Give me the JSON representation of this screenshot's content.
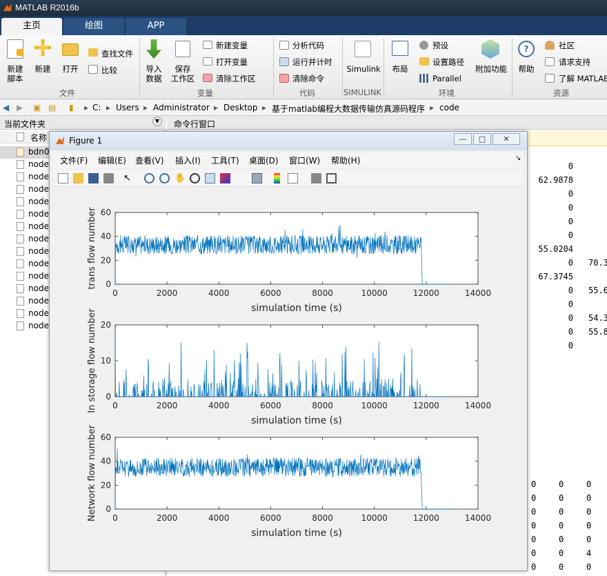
{
  "app": {
    "title": "MATLAB R2016b"
  },
  "tabs": [
    {
      "label": "主页"
    },
    {
      "label": "绘图"
    },
    {
      "label": "APP"
    }
  ],
  "ribbon": {
    "new_script": "新建\n脚本",
    "new": "新建",
    "open": "打开",
    "find_files": "查找文件",
    "compare": "比较",
    "import": "导入\n数据",
    "save_ws": "保存\n工作区",
    "new_var": "新建变量",
    "open_var": "打开变量",
    "clear_ws": "清除工作区",
    "analyze": "分析代码",
    "run_time": "运行并计时",
    "clear_cmd": "清除命令",
    "simulink": "Simulink",
    "layout": "布局",
    "prefs": "预设",
    "set_path": "设置路径",
    "parallel": "Parallel",
    "addons": "附加功能",
    "help": "帮助",
    "community": "社区",
    "support": "请求支持",
    "learn": "了解 MATLAB",
    "groups": {
      "file": "文件",
      "var": "变量",
      "code": "代码",
      "simulink": "SIMULINK",
      "env": "环境",
      "res": "资源"
    }
  },
  "path": {
    "crumbs": [
      "C:",
      "Users",
      "Administrator",
      "Desktop",
      "基于matlab编程大数据传输仿真源码程序",
      "code"
    ]
  },
  "left_panel": {
    "title": "当前文件夹",
    "col_name": "名称",
    "files": [
      "bdn0",
      "node",
      "node",
      "node",
      "node",
      "node",
      "node",
      "node",
      "node",
      "node",
      "node",
      "node",
      "node",
      "node",
      "node"
    ]
  },
  "command_window": {
    "title": "命令行窗口",
    "values_right": [
      {
        "v": "0",
        "c2": ""
      },
      {
        "v": "62.9878",
        "c2": ""
      },
      {
        "v": "0",
        "c2": ""
      },
      {
        "v": "0",
        "c2": ""
      },
      {
        "v": "0",
        "c2": ""
      },
      {
        "v": "0",
        "c2": ""
      },
      {
        "v": "55.0204",
        "c2": ""
      },
      {
        "v": "0",
        "c2": "70.3"
      },
      {
        "v": "67.3745",
        "c2": ""
      },
      {
        "v": "0",
        "c2": "55.6"
      },
      {
        "v": "0",
        "c2": ""
      },
      {
        "v": "0",
        "c2": "54.3"
      },
      {
        "v": "0",
        "c2": "55.8"
      },
      {
        "v": "0",
        "c2": ""
      }
    ],
    "matrix_rows": [
      [
        "0",
        "0",
        "0"
      ],
      [
        "0",
        "0",
        "0"
      ],
      [
        "0",
        "0",
        "0"
      ],
      [
        "0",
        "0",
        "0"
      ],
      [
        "0",
        "0",
        "0"
      ],
      [
        "0",
        "0",
        "4"
      ],
      [
        "0",
        "0",
        "0"
      ]
    ]
  },
  "figure": {
    "title": "Figure 1",
    "menus": [
      "文件(F)",
      "编辑(E)",
      "查看(V)",
      "插入(I)",
      "工具(T)",
      "桌面(D)",
      "窗口(W)",
      "帮助(H)"
    ],
    "win_buttons": {
      "min": "—",
      "max": "□",
      "close": "✕"
    }
  },
  "chart_data": [
    {
      "type": "line",
      "xlabel": "simulation time (s)",
      "ylabel": "trans flow number",
      "xlim": [
        0,
        14000
      ],
      "ylim": [
        0,
        60
      ],
      "xticks": [
        "0",
        "2000",
        "4000",
        "6000",
        "8000",
        "10000",
        "12000",
        "14000"
      ],
      "yticks": [
        "0",
        "20",
        "40",
        "60"
      ],
      "series": [
        {
          "x": [
            0,
            50,
            100,
            11750,
            11800,
            11850,
            13000
          ],
          "y": [
            0,
            38,
            33,
            34,
            28,
            0,
            0
          ],
          "mean": 33,
          "spread": 8,
          "peak": 47
        }
      ]
    },
    {
      "type": "line",
      "xlabel": "simulation time (s)",
      "ylabel": "In storage flow number",
      "xlim": [
        0,
        14000
      ],
      "ylim": [
        0,
        20
      ],
      "xticks": [
        "0",
        "2000",
        "4000",
        "6000",
        "8000",
        "10000",
        "12000",
        "14000"
      ],
      "yticks": [
        "0",
        "10",
        "20"
      ],
      "series": [
        {
          "x": [
            0,
            11800,
            13000
          ],
          "y": [
            0,
            0,
            0
          ],
          "mean": 1,
          "spread": 3,
          "peak": 17
        }
      ]
    },
    {
      "type": "line",
      "xlabel": "simulation time (s)",
      "ylabel": "Network flow number",
      "xlim": [
        0,
        14000
      ],
      "ylim": [
        0,
        60
      ],
      "xticks": [
        "0",
        "2000",
        "4000",
        "6000",
        "8000",
        "10000",
        "12000",
        "14000"
      ],
      "yticks": [
        "0",
        "20",
        "40",
        "60"
      ],
      "series": [
        {
          "x": [
            0,
            50,
            100,
            11750,
            11800,
            11850,
            13000
          ],
          "y": [
            0,
            42,
            35,
            34,
            30,
            0,
            0
          ],
          "mean": 35,
          "spread": 8,
          "peak": 54
        }
      ]
    }
  ]
}
